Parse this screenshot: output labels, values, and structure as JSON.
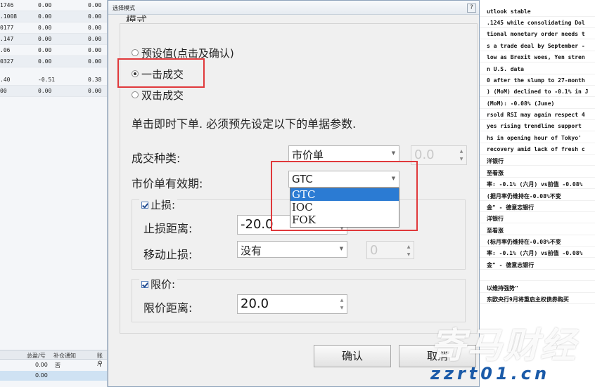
{
  "dialog": {
    "title": "选择模式",
    "help": "?",
    "mode_legend": "模式",
    "modes": [
      {
        "label": "预设值(点击及确认)",
        "selected": false
      },
      {
        "label": "一击成交",
        "selected": true
      },
      {
        "label": "双击成交",
        "selected": false
      }
    ],
    "description": "单击即时下单. 必须预先设定以下的单据参数.",
    "order_type": {
      "label": "成交种类:",
      "value": "市价单",
      "qty": "0.0"
    },
    "validity": {
      "label": "市价单有效期:",
      "value": "GTC",
      "options": [
        "GTC",
        "IOC",
        "FOK"
      ],
      "selected_index": 0
    },
    "stop_loss": {
      "legend": "止损:",
      "checked": true,
      "distance_label": "止损距离:",
      "distance_value": "-20.0",
      "trailing_label": "移动止损:",
      "trailing_value": "没有",
      "trailing_qty": "0"
    },
    "limit": {
      "legend": "限价:",
      "checked": true,
      "distance_label": "限价距离:",
      "distance_value": "20.0"
    },
    "ok_label": "确认",
    "cancel_label": "取消"
  },
  "left_table": {
    "rows": [
      [
        "1746",
        "0.00",
        "0.00"
      ],
      [
        ".1008",
        "0.00",
        "0.00"
      ],
      [
        "0177",
        "0.00",
        "0.00"
      ],
      [
        ".147",
        "0.00",
        "0.00"
      ],
      [
        ".06",
        "0.00",
        "0.00"
      ],
      [
        "0327",
        "0.00",
        "0.00"
      ],
      [
        ".40",
        "-0.51",
        "0.38"
      ],
      [
        "00",
        "0.00",
        "0.00"
      ]
    ],
    "footer_headers": [
      "总盈/亏",
      "补仓通知",
      "账户"
    ],
    "footer_row": [
      "0.00",
      "否",
      "Y"
    ],
    "footer_row2": "0.00"
  },
  "news": {
    "items": [
      "utlook stable",
      ".1245 while consolidating Dol",
      "tional monetary order needs t",
      "s a trade deal by September -",
      "low as Brexit woes, Yen stren",
      "n U.S. data",
      "0 after the slump to 27-month",
      ") (MoM) declined to -0.1% in J",
      "(MoM): -0.08% (June)",
      "rsold RSI may again respect 4",
      "yes rising trendline support",
      "hs in opening hour of Tokyo'",
      "recovery amid lack of fresh c",
      "洋银行",
      "至看涨",
      "率: -0.1% (六月) vs前值 -0.08%",
      "(据月率仍维持在-0.08%不变",
      "金\" - 德意志银行",
      "洋银行",
      "至看涨",
      "(标月率仍维持在-0.08%不变",
      "率: -0.1% (六月) vs前值 -0.08%",
      "金\" - 德意志银行",
      "",
      "以维持强势\"",
      "东欧央行9月将重启主权债券购买"
    ]
  },
  "watermark": {
    "brand": "寄马财经",
    "url": "zzrt01.cn"
  },
  "colors": {
    "highlight_red": "#e0393b",
    "selection_blue": "#2b7bd3"
  }
}
